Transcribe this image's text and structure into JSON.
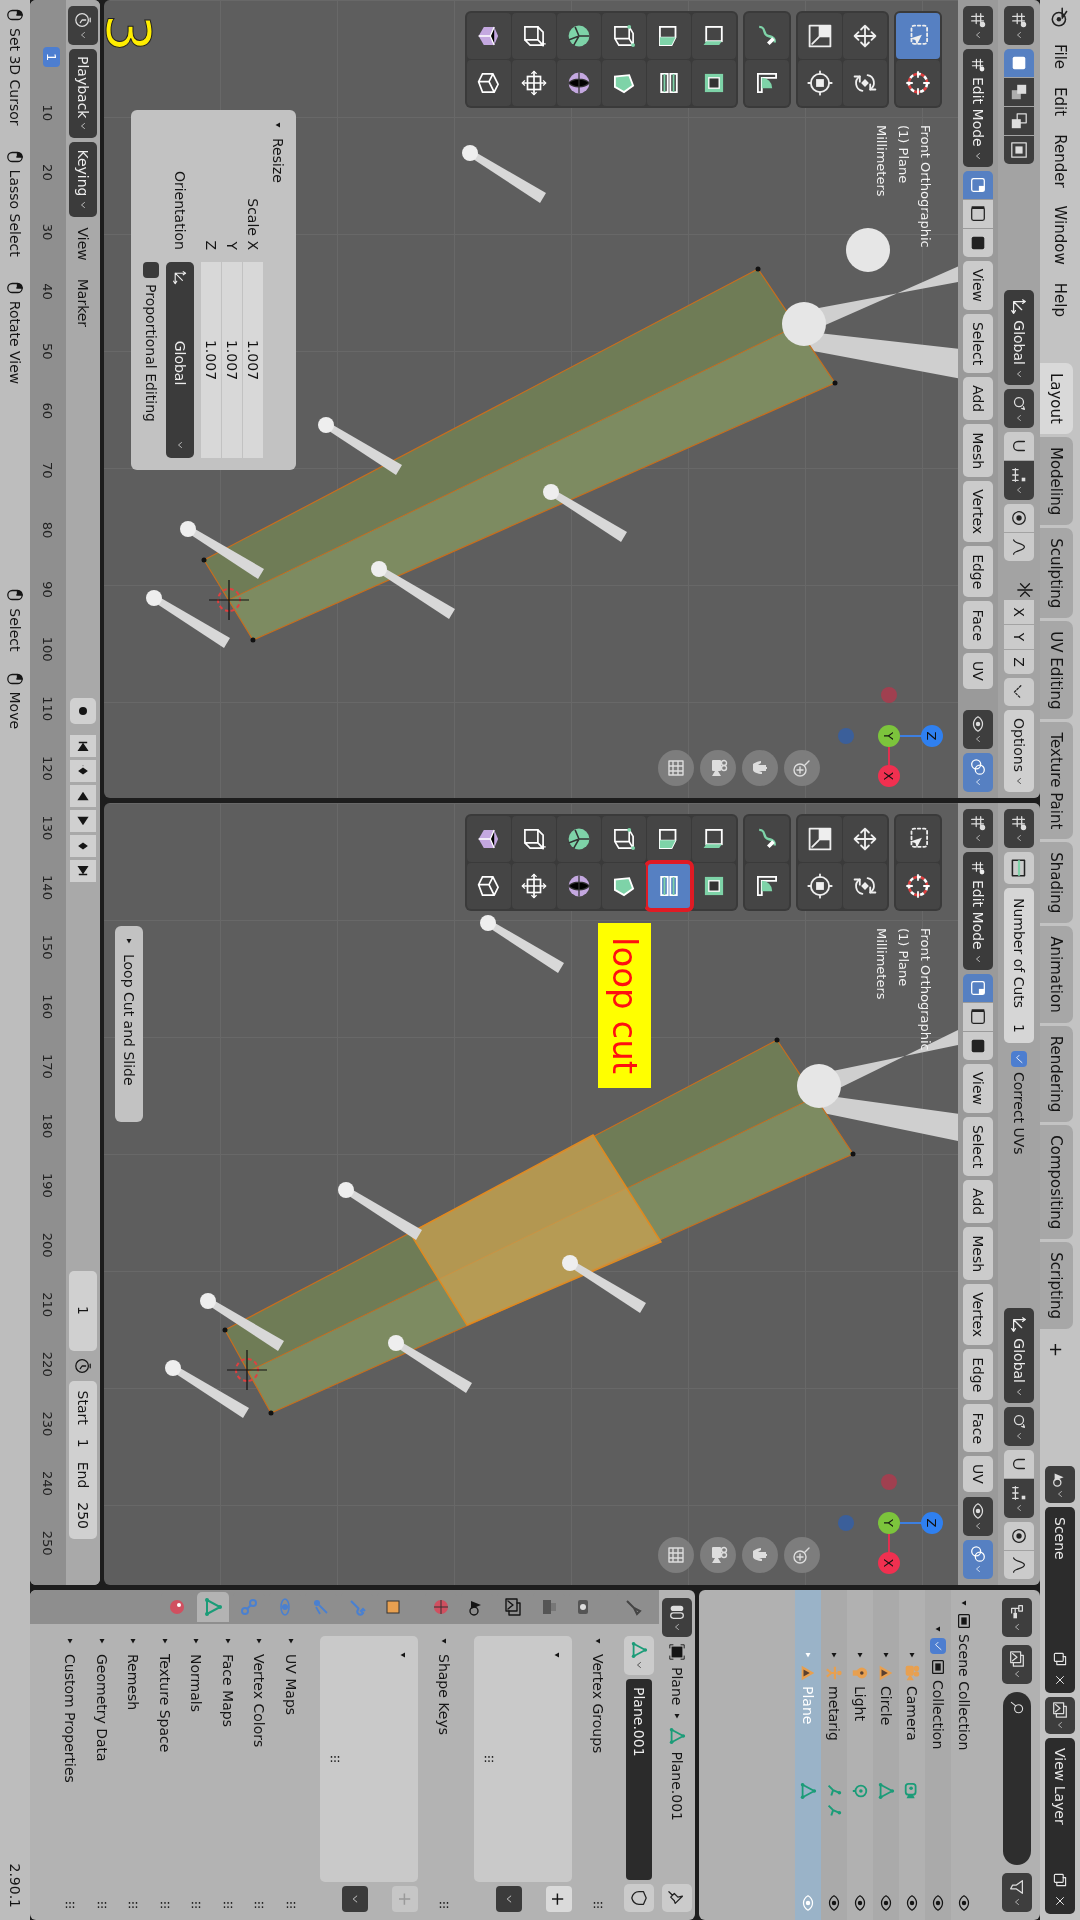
{
  "topbar": {
    "menus": [
      "File",
      "Edit",
      "Render",
      "Window",
      "Help"
    ],
    "workspaces": [
      {
        "label": "Layout",
        "selected": true
      },
      {
        "label": "Modeling",
        "selected": false
      },
      {
        "label": "Sculpting",
        "selected": false
      },
      {
        "label": "UV Editing",
        "selected": false
      },
      {
        "label": "Texture Paint",
        "selected": false
      },
      {
        "label": "Shading",
        "selected": false
      },
      {
        "label": "Animation",
        "selected": false
      },
      {
        "label": "Rendering",
        "selected": false
      },
      {
        "label": "Compositing",
        "selected": false
      },
      {
        "label": "Scripting",
        "selected": false
      }
    ],
    "add_workspace": "+",
    "scene": "Scene",
    "view_layer": "View Layer"
  },
  "viewports": [
    {
      "tool_settings": [
        {
          "kind": "tool"
        },
        {
          "kind": "select_box"
        },
        {
          "kind": "dropdown",
          "label": "Global"
        },
        {
          "kind": "pivot"
        },
        {
          "kind": "snap"
        },
        {
          "kind": "proportional"
        },
        {
          "kind": "mirror",
          "axes": [
            "X",
            "Y",
            "Z"
          ]
        },
        {
          "kind": "automerge"
        },
        {
          "kind": "dropdown",
          "label": "Options"
        }
      ],
      "mode": "Edit Mode",
      "select_modes": [
        {
          "selected": true
        },
        {
          "selected": false
        },
        {
          "selected": false
        }
      ],
      "menus": [
        "View",
        "Select",
        "Add",
        "Mesh",
        "Vertex",
        "Edge",
        "Face",
        "UV"
      ],
      "overlay_text": [
        "Front Orthographic",
        "(1) Plane",
        "Millimeters"
      ],
      "tools": [
        {
          "selected": true,
          "marked": false
        },
        {
          "selected": false,
          "marked": false
        },
        {
          "selected": false,
          "marked": false
        },
        {
          "selected": false,
          "marked": false
        },
        {
          "selected": false,
          "marked": false
        },
        {
          "selected": false,
          "marked": false
        },
        {
          "selected": false,
          "marked": false
        },
        {
          "selected": false,
          "marked": false
        },
        {
          "selected": false,
          "marked": false
        },
        {
          "selected": false,
          "marked": false
        },
        {
          "selected": false,
          "marked": false
        },
        {
          "selected": false,
          "marked": false
        },
        {
          "selected": false,
          "marked": false
        },
        {
          "selected": false,
          "marked": false
        },
        {
          "selected": false,
          "marked": false
        },
        {
          "selected": false,
          "marked": false
        },
        {
          "selected": false,
          "marked": false
        },
        {
          "selected": false,
          "marked": false
        },
        {
          "selected": false,
          "marked": false
        },
        {
          "selected": false,
          "marked": false
        }
      ],
      "gizmo_axes": [
        "Z",
        "Y",
        "X"
      ],
      "panel": {
        "title": "Resize",
        "expanded": true,
        "fields": [
          {
            "label": "Scale X",
            "value": "1.007"
          },
          {
            "label": "Y",
            "value": "1.007"
          },
          {
            "label": "Z",
            "value": "1.007"
          }
        ],
        "orientation": {
          "label": "Orientation",
          "value": "Global"
        },
        "checkbox": {
          "label": "Proportional Editing",
          "checked": false
        }
      },
      "annotation": {
        "kind": "number",
        "text": "3"
      }
    },
    {
      "tool_settings": [
        {
          "kind": "tool"
        },
        {
          "kind": "active_tool"
        },
        {
          "kind": "number",
          "label": "Number of Cuts",
          "value": "1"
        },
        {
          "kind": "checkbox",
          "label": "Correct UVs",
          "checked": true
        },
        {
          "kind": "dropdown",
          "label": "Global"
        },
        {
          "kind": "pivot"
        },
        {
          "kind": "snap"
        },
        {
          "kind": "proportional"
        }
      ],
      "mode": "Edit Mode",
      "select_modes": [
        {
          "selected": true
        },
        {
          "selected": false
        },
        {
          "selected": false
        }
      ],
      "menus": [
        "View",
        "Select",
        "Add",
        "Mesh",
        "Vertex",
        "Edge",
        "Face",
        "UV"
      ],
      "overlay_text": [
        "Front Orthographic",
        "(1) Plane",
        "Millimeters"
      ],
      "tools": [
        {
          "selected": false,
          "marked": false
        },
        {
          "selected": false,
          "marked": false
        },
        {
          "selected": false,
          "marked": false
        },
        {
          "selected": false,
          "marked": false
        },
        {
          "selected": false,
          "marked": false
        },
        {
          "selected": false,
          "marked": false
        },
        {
          "selected": false,
          "marked": false
        },
        {
          "selected": false,
          "marked": false
        },
        {
          "selected": false,
          "marked": false
        },
        {
          "selected": false,
          "marked": false
        },
        {
          "selected": false,
          "marked": false
        },
        {
          "selected": true,
          "marked": true
        },
        {
          "selected": false,
          "marked": false
        },
        {
          "selected": false,
          "marked": false
        },
        {
          "selected": false,
          "marked": false
        },
        {
          "selected": false,
          "marked": false
        },
        {
          "selected": false,
          "marked": false
        },
        {
          "selected": false,
          "marked": false
        },
        {
          "selected": false,
          "marked": false
        },
        {
          "selected": false,
          "marked": false
        }
      ],
      "gizmo_axes": [
        "Z",
        "Y",
        "X"
      ],
      "panel": {
        "title": "Loop Cut and Slide",
        "expanded": false
      },
      "annotation": {
        "kind": "label",
        "text": "loop cut"
      }
    }
  ],
  "timeline": {
    "menus": [
      {
        "label": "Playback",
        "kind": "dropdown"
      },
      {
        "label": "Keying",
        "kind": "dropdown"
      },
      {
        "label": "View",
        "kind": "menu"
      },
      {
        "label": "Marker",
        "kind": "menu"
      }
    ],
    "current_frame": "1",
    "start": {
      "label": "Start",
      "value": "1"
    },
    "end": {
      "label": "End",
      "value": "250"
    },
    "playhead": "1",
    "ruler": [
      "10",
      "20",
      "30",
      "40",
      "50",
      "60",
      "70",
      "80",
      "90",
      "100",
      "110",
      "120",
      "130",
      "140",
      "150",
      "160",
      "170",
      "180",
      "190",
      "200",
      "210",
      "220",
      "230",
      "240",
      "250"
    ]
  },
  "outliner": {
    "tree": [
      {
        "label": "Scene Collection",
        "kind": "scene_collection",
        "expanded": true,
        "selected": false,
        "visible": true,
        "children": [
          {
            "label": "Collection",
            "kind": "collection",
            "expanded": true,
            "checked": true,
            "selected": false,
            "visible": true,
            "children": [
              {
                "label": "Camera",
                "kind": "camera",
                "expanded": false,
                "selected": false,
                "visible": true
              },
              {
                "label": "Circle",
                "kind": "curve",
                "expanded": false,
                "selected": false,
                "visible": true
              },
              {
                "label": "Light",
                "kind": "light",
                "expanded": false,
                "selected": false,
                "visible": true
              },
              {
                "label": "metarig",
                "kind": "armature",
                "expanded": false,
                "selected": false,
                "visible": true
              },
              {
                "label": "Plane",
                "kind": "mesh",
                "expanded": false,
                "selected": true,
                "visible": true
              }
            ]
          }
        ]
      }
    ]
  },
  "properties": {
    "object": "Plane",
    "data": "Plane.001",
    "tabs": [
      {
        "selected": false
      },
      {
        "selected": false
      },
      {
        "selected": false
      },
      {
        "selected": false
      },
      {
        "selected": false
      },
      {
        "selected": false
      },
      {
        "selected": false
      },
      {
        "selected": false
      },
      {
        "selected": false
      },
      {
        "selected": false
      },
      {
        "selected": false
      },
      {
        "selected": true
      },
      {
        "selected": false
      }
    ],
    "datablock": "Plane.001",
    "panels": [
      {
        "title": "Vertex Groups",
        "expanded": true,
        "add": {
          "label": "+",
          "enabled": true
        }
      },
      {
        "title": "Shape Keys",
        "expanded": true,
        "add": {
          "label": "+",
          "enabled": false
        }
      },
      {
        "title": "UV Maps",
        "expanded": false
      },
      {
        "title": "Vertex Colors",
        "expanded": false
      },
      {
        "title": "Face Maps",
        "expanded": false
      },
      {
        "title": "Normals",
        "expanded": false
      },
      {
        "title": "Texture Space",
        "expanded": false
      },
      {
        "title": "Remesh",
        "expanded": false
      },
      {
        "title": "Geometry Data",
        "expanded": false
      },
      {
        "title": "Custom Properties",
        "expanded": false
      }
    ]
  },
  "status_bar": {
    "mouse_hints": [
      "Set 3D Cursor",
      "Lasso Select",
      "Rotate View"
    ],
    "tool_hints": [
      "Select",
      "Move"
    ],
    "version": "2.90.1"
  }
}
